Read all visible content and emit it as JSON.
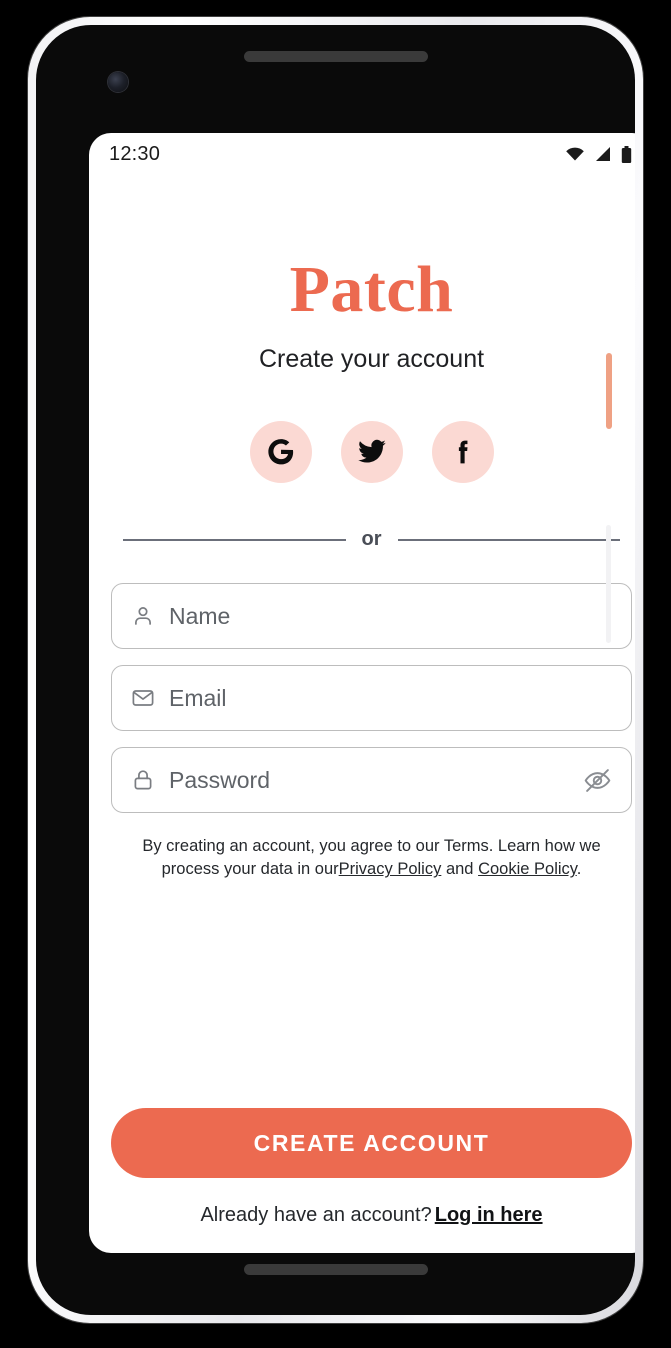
{
  "device": {
    "frame": "android-phone",
    "power_button_color": "#efa184",
    "bezel_color": "#0a0a0a"
  },
  "status_bar": {
    "time": "12:30",
    "icons": [
      "wifi-icon",
      "cellular-signal-icon",
      "battery-icon"
    ]
  },
  "branding": {
    "logo_text": "Patch",
    "logo_color": "#ec6a50",
    "subtitle": "Create your account"
  },
  "social_login": {
    "buttons": [
      {
        "name": "google",
        "icon": "google-icon",
        "label": "G"
      },
      {
        "name": "twitter",
        "icon": "twitter-icon",
        "label": "Twitter"
      },
      {
        "name": "facebook",
        "icon": "facebook-icon",
        "label": "f"
      }
    ],
    "circle_color": "#fbd9d3"
  },
  "divider": {
    "label": "or"
  },
  "form": {
    "name_field": {
      "placeholder": "Name",
      "value": "",
      "icon": "person-icon"
    },
    "email_field": {
      "placeholder": "Email",
      "value": "",
      "icon": "envelope-icon"
    },
    "password_field": {
      "placeholder": "Password",
      "value": "",
      "icon": "lock-icon",
      "toggle_icon": "eye-off-icon",
      "masked": true
    }
  },
  "legal": {
    "line_1_prefix": "By creating an account, you agree to our Terms. Learn how we process",
    "line_2_prefix": "your data in our",
    "privacy_link": "Privacy Policy",
    "conjunction": "and",
    "cookie_link": "Cookie Policy",
    "period": "."
  },
  "cta": {
    "label": "CREATE ACCOUNT",
    "color": "#ec6a50"
  },
  "login_prompt": {
    "text": "Already have an account?",
    "link": "Log in here"
  }
}
